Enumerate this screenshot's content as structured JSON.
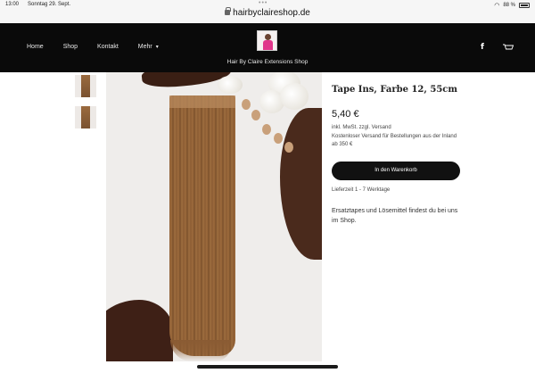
{
  "statusbar": {
    "time": "13:00",
    "date": "Sonntag 29. Sept.",
    "dots": "•••",
    "url": "hairbyclaireshop.de",
    "battery": "88 %"
  },
  "header": {
    "nav": [
      {
        "label": "Home"
      },
      {
        "label": "Shop"
      },
      {
        "label": "Kontakt"
      },
      {
        "label": "Mehr"
      }
    ],
    "site_name": "Hair By Claire Extensions Shop",
    "facebook_glyph": "f"
  },
  "product": {
    "title": "Tape Ins, Farbe 12, 55cm",
    "price": "5,40 €",
    "tax_note": "inkl. MwSt. zzgl. Versand",
    "shipping_note": "Kostenloser Versand für Bestellungen aus der Inland ab 350 €",
    "add_to_cart": "In den Warenkorb",
    "delivery": "Lieferzeit 1 - 7 Werktage",
    "note": "Ersatztapes und Lösemittel findest du bei uns im Shop."
  },
  "colors": {
    "header_bg": "#0a0a0a",
    "button_bg": "#111111",
    "hair": "#8b5d34"
  }
}
